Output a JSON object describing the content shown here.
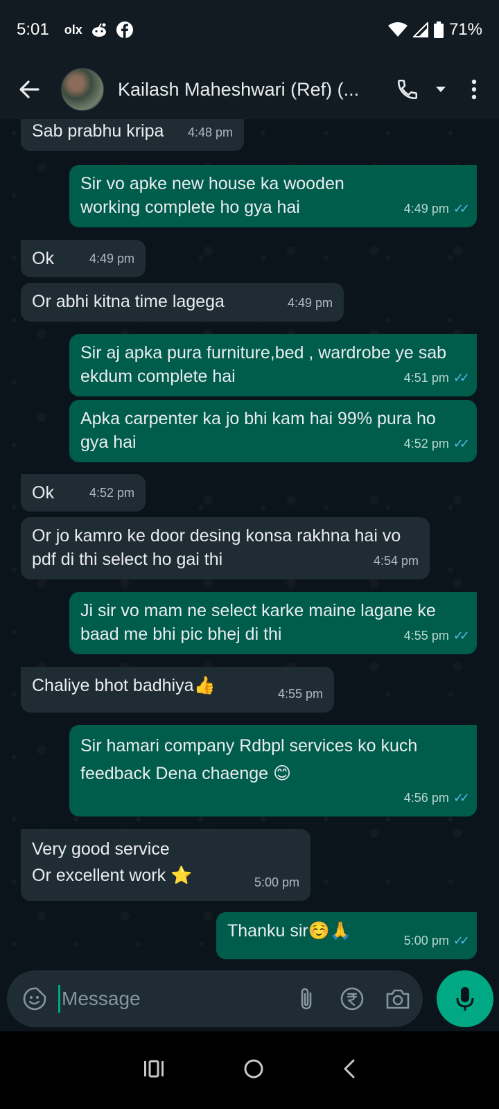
{
  "status_bar": {
    "time": "5:01",
    "left_icons": [
      "olx-icon",
      "reddit-icon",
      "facebook-icon"
    ],
    "olx_label": "olx",
    "battery": "71%"
  },
  "header": {
    "contact_name": "Kailash Maheshwari (Ref) (...",
    "icons": [
      "back-arrow-icon",
      "avatar",
      "phone-icon",
      "dropdown-icon",
      "more-vert-icon"
    ]
  },
  "messages": [
    {
      "dir": "in",
      "text": "Sab prabhu kripa",
      "time": "4:48 pm"
    },
    {
      "dir": "out",
      "text": "Sir vo apke new house ka wooden working complete ho gya hai",
      "time": "4:49 pm"
    },
    {
      "dir": "in",
      "text": "Ok",
      "time": "4:49 pm"
    },
    {
      "dir": "in",
      "text": "Or abhi kitna time lagega",
      "time": "4:49 pm"
    },
    {
      "dir": "out",
      "text": "Sir aj apka pura furniture,bed , wardrobe ye sab ekdum complete hai",
      "time": "4:51 pm"
    },
    {
      "dir": "out",
      "text": "Apka carpenter ka jo bhi kam hai 99% pura ho gya hai",
      "time": "4:52 pm"
    },
    {
      "dir": "in",
      "text": "Ok",
      "time": "4:52 pm"
    },
    {
      "dir": "in",
      "text": "Or jo kamro ke door desing konsa rakhna hai vo pdf di thi select ho gai thi",
      "time": "4:54 pm"
    },
    {
      "dir": "out",
      "text": "Ji sir vo mam ne select karke maine lagane ke baad me bhi pic bhej di thi",
      "time": "4:55 pm"
    },
    {
      "dir": "in",
      "text": "Chaliye bhot badhiya👍",
      "time": "4:55 pm"
    },
    {
      "dir": "out",
      "text": "Sir hamari company Rdbpl services ko kuch feedback Dena chaenge 😊",
      "time": "4:56 pm"
    },
    {
      "dir": "in",
      "text": "Very good service\nOr excellent work ⭐",
      "time": "5:00 pm"
    },
    {
      "dir": "out",
      "text": "Thanku sir☺️🙏",
      "time": "5:00 pm"
    }
  ],
  "input": {
    "placeholder": "Message",
    "icons": [
      "sticker-icon",
      "attach-icon",
      "rupee-icon",
      "camera-icon",
      "mic-icon"
    ]
  },
  "colors": {
    "background": "#0b141a",
    "incoming_bubble": "#202c33",
    "outgoing_bubble": "#005c4b",
    "accent": "#00a884",
    "read_ticks": "#53bdeb"
  }
}
